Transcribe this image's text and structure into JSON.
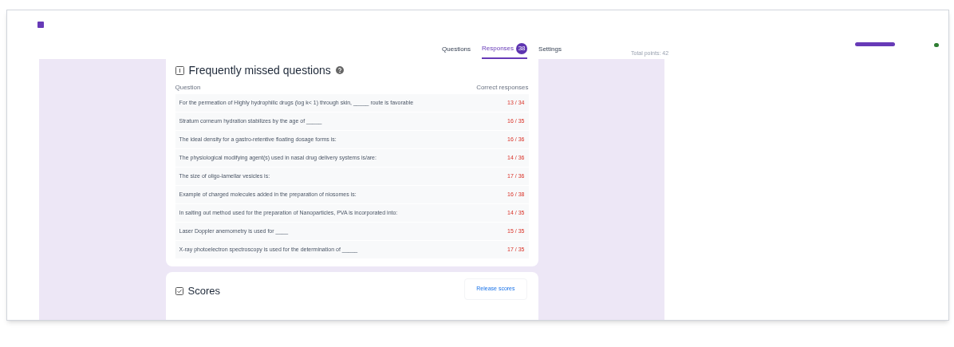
{
  "tabs": [
    {
      "label": "Questions",
      "selected": false
    },
    {
      "label": "Responses",
      "selected": true,
      "badge": "38"
    },
    {
      "label": "Settings",
      "selected": false
    }
  ],
  "total_points": "Total points: 42",
  "missed": {
    "title": "Frequently missed questions",
    "columns": [
      "Question",
      "Correct responses"
    ],
    "rows": [
      {
        "question": "For the permeation of Highly hydrophilic drugs (log k< 1) through skin, _____ route is favorable",
        "correct": "13 / 34"
      },
      {
        "question": "Stratum corneum hydration stabilizes by the age of _____",
        "correct": "16 / 35"
      },
      {
        "question": "The ideal density for a gastro-retentive floating dosage forms is:",
        "correct": "16 / 36"
      },
      {
        "question": "The physiological modifying agent(s) used in nasal drug delivery systems is/are:",
        "correct": "14 / 36"
      },
      {
        "question": "The size of oligo-lamellar vesicles is:",
        "correct": "17 / 36"
      },
      {
        "question": "Example of charged molecules added in the preparation of niosomes is:",
        "correct": "16 / 38"
      },
      {
        "question": "In salting out method used for the preparation of Nanoparticles, PVA is incorporated into:",
        "correct": "14 / 35"
      },
      {
        "question": "Laser Doppler anemometry is used for ____",
        "correct": "15 / 35"
      },
      {
        "question": "X-ray photoelectron spectroscopy is used for the determination of _____",
        "correct": "17 / 35"
      }
    ]
  },
  "scores": {
    "title": "Scores",
    "button": "Release scores"
  }
}
